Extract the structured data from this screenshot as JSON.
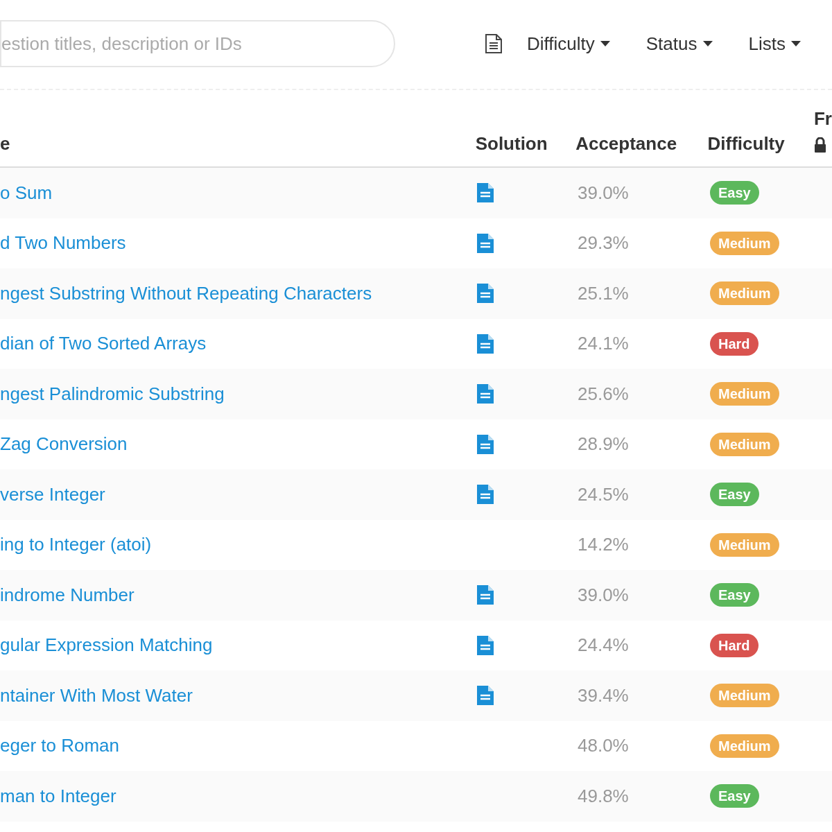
{
  "search": {
    "placeholder": "estion titles, description or IDs"
  },
  "filters": [
    {
      "label": "Difficulty"
    },
    {
      "label": "Status"
    },
    {
      "label": "Lists"
    }
  ],
  "table": {
    "columns": [
      "e",
      "Solution",
      "Acceptance",
      "Difficulty",
      "Fr"
    ],
    "rows": [
      {
        "title": "o Sum",
        "has_solution": true,
        "acceptance": "39.0%",
        "difficulty": "Easy",
        "color": "#5cb85c"
      },
      {
        "title": "d Two Numbers",
        "has_solution": true,
        "acceptance": "29.3%",
        "difficulty": "Medium",
        "color": "#f0ad4e"
      },
      {
        "title": "ngest Substring Without Repeating Characters",
        "has_solution": true,
        "acceptance": "25.1%",
        "difficulty": "Medium",
        "color": "#f0ad4e"
      },
      {
        "title": "dian of Two Sorted Arrays",
        "has_solution": true,
        "acceptance": "24.1%",
        "difficulty": "Hard",
        "color": "#d9534f"
      },
      {
        "title": "ngest Palindromic Substring",
        "has_solution": true,
        "acceptance": "25.6%",
        "difficulty": "Medium",
        "color": "#f0ad4e"
      },
      {
        "title": "Zag Conversion",
        "has_solution": true,
        "acceptance": "28.9%",
        "difficulty": "Medium",
        "color": "#f0ad4e"
      },
      {
        "title": "verse Integer",
        "has_solution": true,
        "acceptance": "24.5%",
        "difficulty": "Easy",
        "color": "#5cb85c"
      },
      {
        "title": "ing to Integer (atoi)",
        "has_solution": false,
        "acceptance": "14.2%",
        "difficulty": "Medium",
        "color": "#f0ad4e"
      },
      {
        "title": "indrome Number",
        "has_solution": true,
        "acceptance": "39.0%",
        "difficulty": "Easy",
        "color": "#5cb85c"
      },
      {
        "title": "gular Expression Matching",
        "has_solution": true,
        "acceptance": "24.4%",
        "difficulty": "Hard",
        "color": "#d9534f"
      },
      {
        "title": "ntainer With Most Water",
        "has_solution": true,
        "acceptance": "39.4%",
        "difficulty": "Medium",
        "color": "#f0ad4e"
      },
      {
        "title": "eger to Roman",
        "has_solution": false,
        "acceptance": "48.0%",
        "difficulty": "Medium",
        "color": "#f0ad4e"
      },
      {
        "title": "man to Integer",
        "has_solution": false,
        "acceptance": "49.8%",
        "difficulty": "Easy",
        "color": "#5cb85c"
      }
    ]
  }
}
